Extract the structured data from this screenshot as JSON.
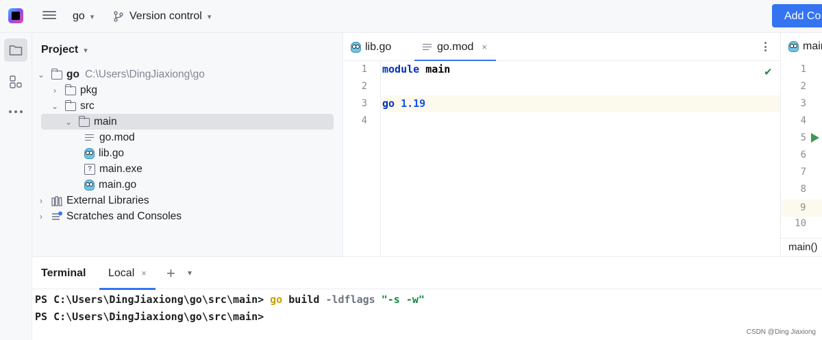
{
  "toolbar": {
    "project_name": "go",
    "vcs_label": "Version control",
    "add_button_label": "Add Co"
  },
  "left_strip": {
    "items": [
      "folder-icon",
      "structure-icon",
      "more-icon"
    ]
  },
  "project_panel": {
    "title": "Project",
    "tree": [
      {
        "label": "go",
        "hint": "C:\\Users\\DingJiaxiong\\go",
        "kind": "folder",
        "expanded": true
      },
      {
        "label": "pkg",
        "kind": "folder",
        "expanded": false
      },
      {
        "label": "src",
        "kind": "folder",
        "expanded": true
      },
      {
        "label": "main",
        "kind": "folder",
        "expanded": true,
        "selected": true
      },
      {
        "label": "go.mod",
        "kind": "text-file"
      },
      {
        "label": "lib.go",
        "kind": "go-file"
      },
      {
        "label": "main.exe",
        "kind": "unknown-file"
      },
      {
        "label": "main.go",
        "kind": "go-file"
      },
      {
        "label": "External Libraries",
        "kind": "library"
      },
      {
        "label": "Scratches and Consoles",
        "kind": "scratches"
      }
    ]
  },
  "editor": {
    "tabs": [
      {
        "label": "lib.go",
        "active": false
      },
      {
        "label": "go.mod",
        "active": true
      }
    ],
    "close_glyph": "×",
    "line_numbers": [
      "1",
      "2",
      "3",
      "4"
    ],
    "lines": [
      {
        "kw": "module",
        "rest": "main"
      },
      {
        "kw": "",
        "rest": ""
      },
      {
        "kw": "go",
        "rest": "1.19"
      },
      {
        "kw": "",
        "rest": ""
      }
    ]
  },
  "right_editor": {
    "tab_label": "main",
    "line_numbers": [
      "1",
      "2",
      "3",
      "4",
      "5",
      "6",
      "7",
      "8",
      "9",
      "10"
    ],
    "breadcrumb": "main()"
  },
  "terminal": {
    "title": "Terminal",
    "tab_label": "Local",
    "lines": [
      {
        "prompt": "PS C:\\Users\\DingJiaxiong\\go\\src\\main>",
        "cmd": "go",
        "rest": "build",
        "flag": "-ldflags",
        "str": "\"-s -w\""
      },
      {
        "prompt": "PS C:\\Users\\DingJiaxiong\\go\\src\\main>",
        "cmd": "",
        "rest": "",
        "flag": "",
        "str": ""
      }
    ]
  },
  "watermark": "CSDN @Ding Jiaxiong"
}
